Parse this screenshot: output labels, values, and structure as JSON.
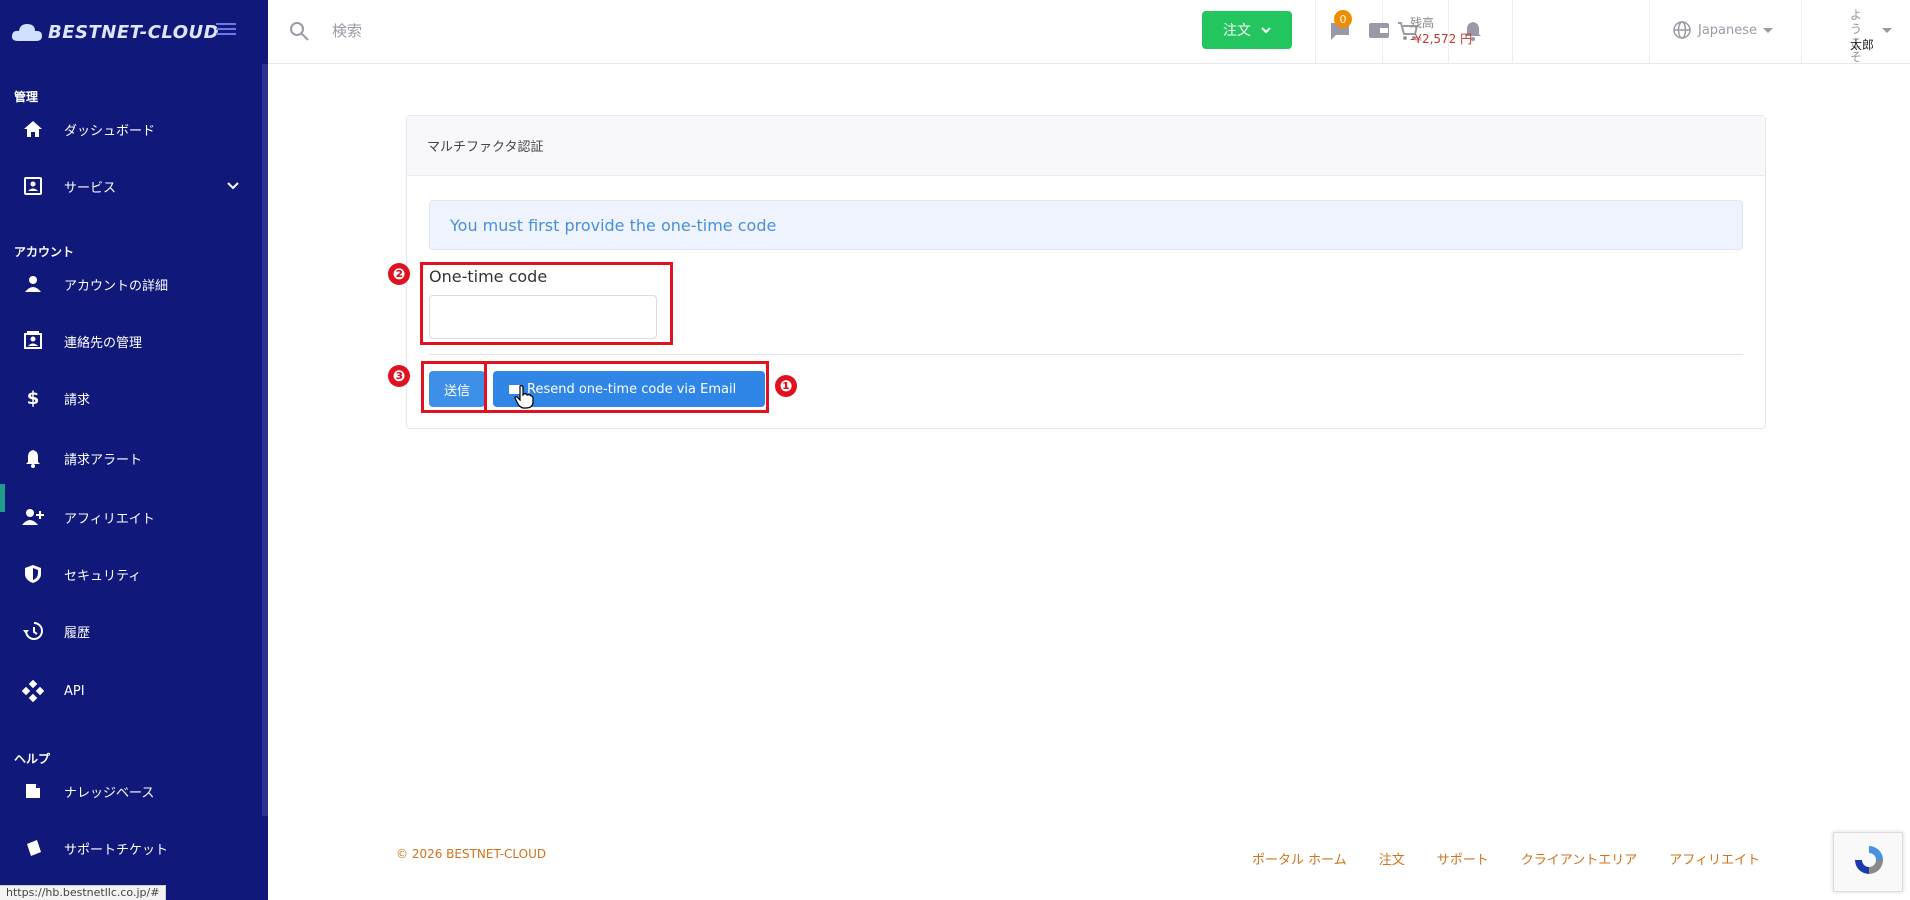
{
  "brand": {
    "name": "BESTNET-CLOUD"
  },
  "sidebar": {
    "sections": [
      {
        "label": "管理"
      },
      {
        "label": "アカウント"
      },
      {
        "label": "ヘルプ"
      }
    ],
    "items": [
      {
        "label": "ダッシュボード",
        "icon": "home-icon"
      },
      {
        "label": "サービス",
        "icon": "service-icon"
      },
      {
        "label": "アカウントの詳細",
        "icon": "person-icon"
      },
      {
        "label": "連絡先の管理",
        "icon": "contacts-icon"
      },
      {
        "label": "請求",
        "icon": "dollar-icon"
      },
      {
        "label": "請求アラート",
        "icon": "bell-alert-icon"
      },
      {
        "label": "アフィリエイト",
        "icon": "person-add-icon"
      },
      {
        "label": "セキュリティ",
        "icon": "shield-icon"
      },
      {
        "label": "履歴",
        "icon": "history-icon"
      },
      {
        "label": "API",
        "icon": "api-icon"
      },
      {
        "label": "ナレッジベース",
        "icon": "book-icon"
      },
      {
        "label": "サポートチケット",
        "icon": "ticket-icon"
      }
    ]
  },
  "topbar": {
    "search_placeholder": "検索",
    "order_label": "注文",
    "messages_count": "0",
    "balance_label": "残高",
    "balance_value": "-¥2,572 円",
    "language": "Japanese",
    "greeting": "ようこそ",
    "user_name": "太郎"
  },
  "card": {
    "title": "マルチファクタ認証",
    "alert": "You must first provide the one-time code",
    "code_label": "One-time code",
    "code_value": "",
    "submit_label": "送信",
    "resend_label": "Resend one-time code via Email"
  },
  "annotations": [
    "❶",
    "❷",
    "❸"
  ],
  "footer": {
    "copyright": "© 2026 BESTNET-CLOUD",
    "links": [
      "ポータル ホーム",
      "注文",
      "サポート",
      "クライアントエリア",
      "アフィリエイト"
    ]
  },
  "status_url": "https://hb.bestnetllc.co.jp/#",
  "colors": {
    "sidebar": "#10197a",
    "accent": "#2f86e6",
    "order": "#22c55e",
    "annotation": "#e0121f",
    "footer_link": "#d1731c"
  }
}
